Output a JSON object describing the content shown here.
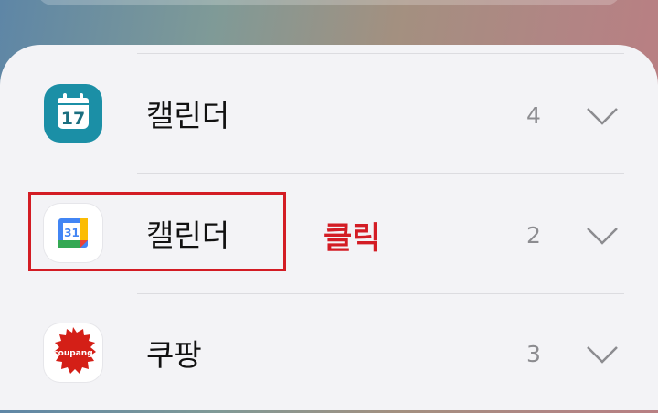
{
  "list": {
    "items": [
      {
        "label": "캘린더",
        "count": "4",
        "icon": "samsung-calendar-icon",
        "icon_text": "17"
      },
      {
        "label": "캘린더",
        "count": "2",
        "icon": "google-calendar-icon",
        "icon_text": "31"
      },
      {
        "label": "쿠팡",
        "count": "3",
        "icon": "coupang-icon",
        "icon_text": "coupang"
      }
    ]
  },
  "annotation": {
    "text": "클릭",
    "color": "#d31c24"
  },
  "colors": {
    "sheet": "#f3f3f6",
    "samsung_calendar": "#1b8fa6",
    "google_blue": "#4285f4",
    "coupang_red": "#d41f17"
  }
}
